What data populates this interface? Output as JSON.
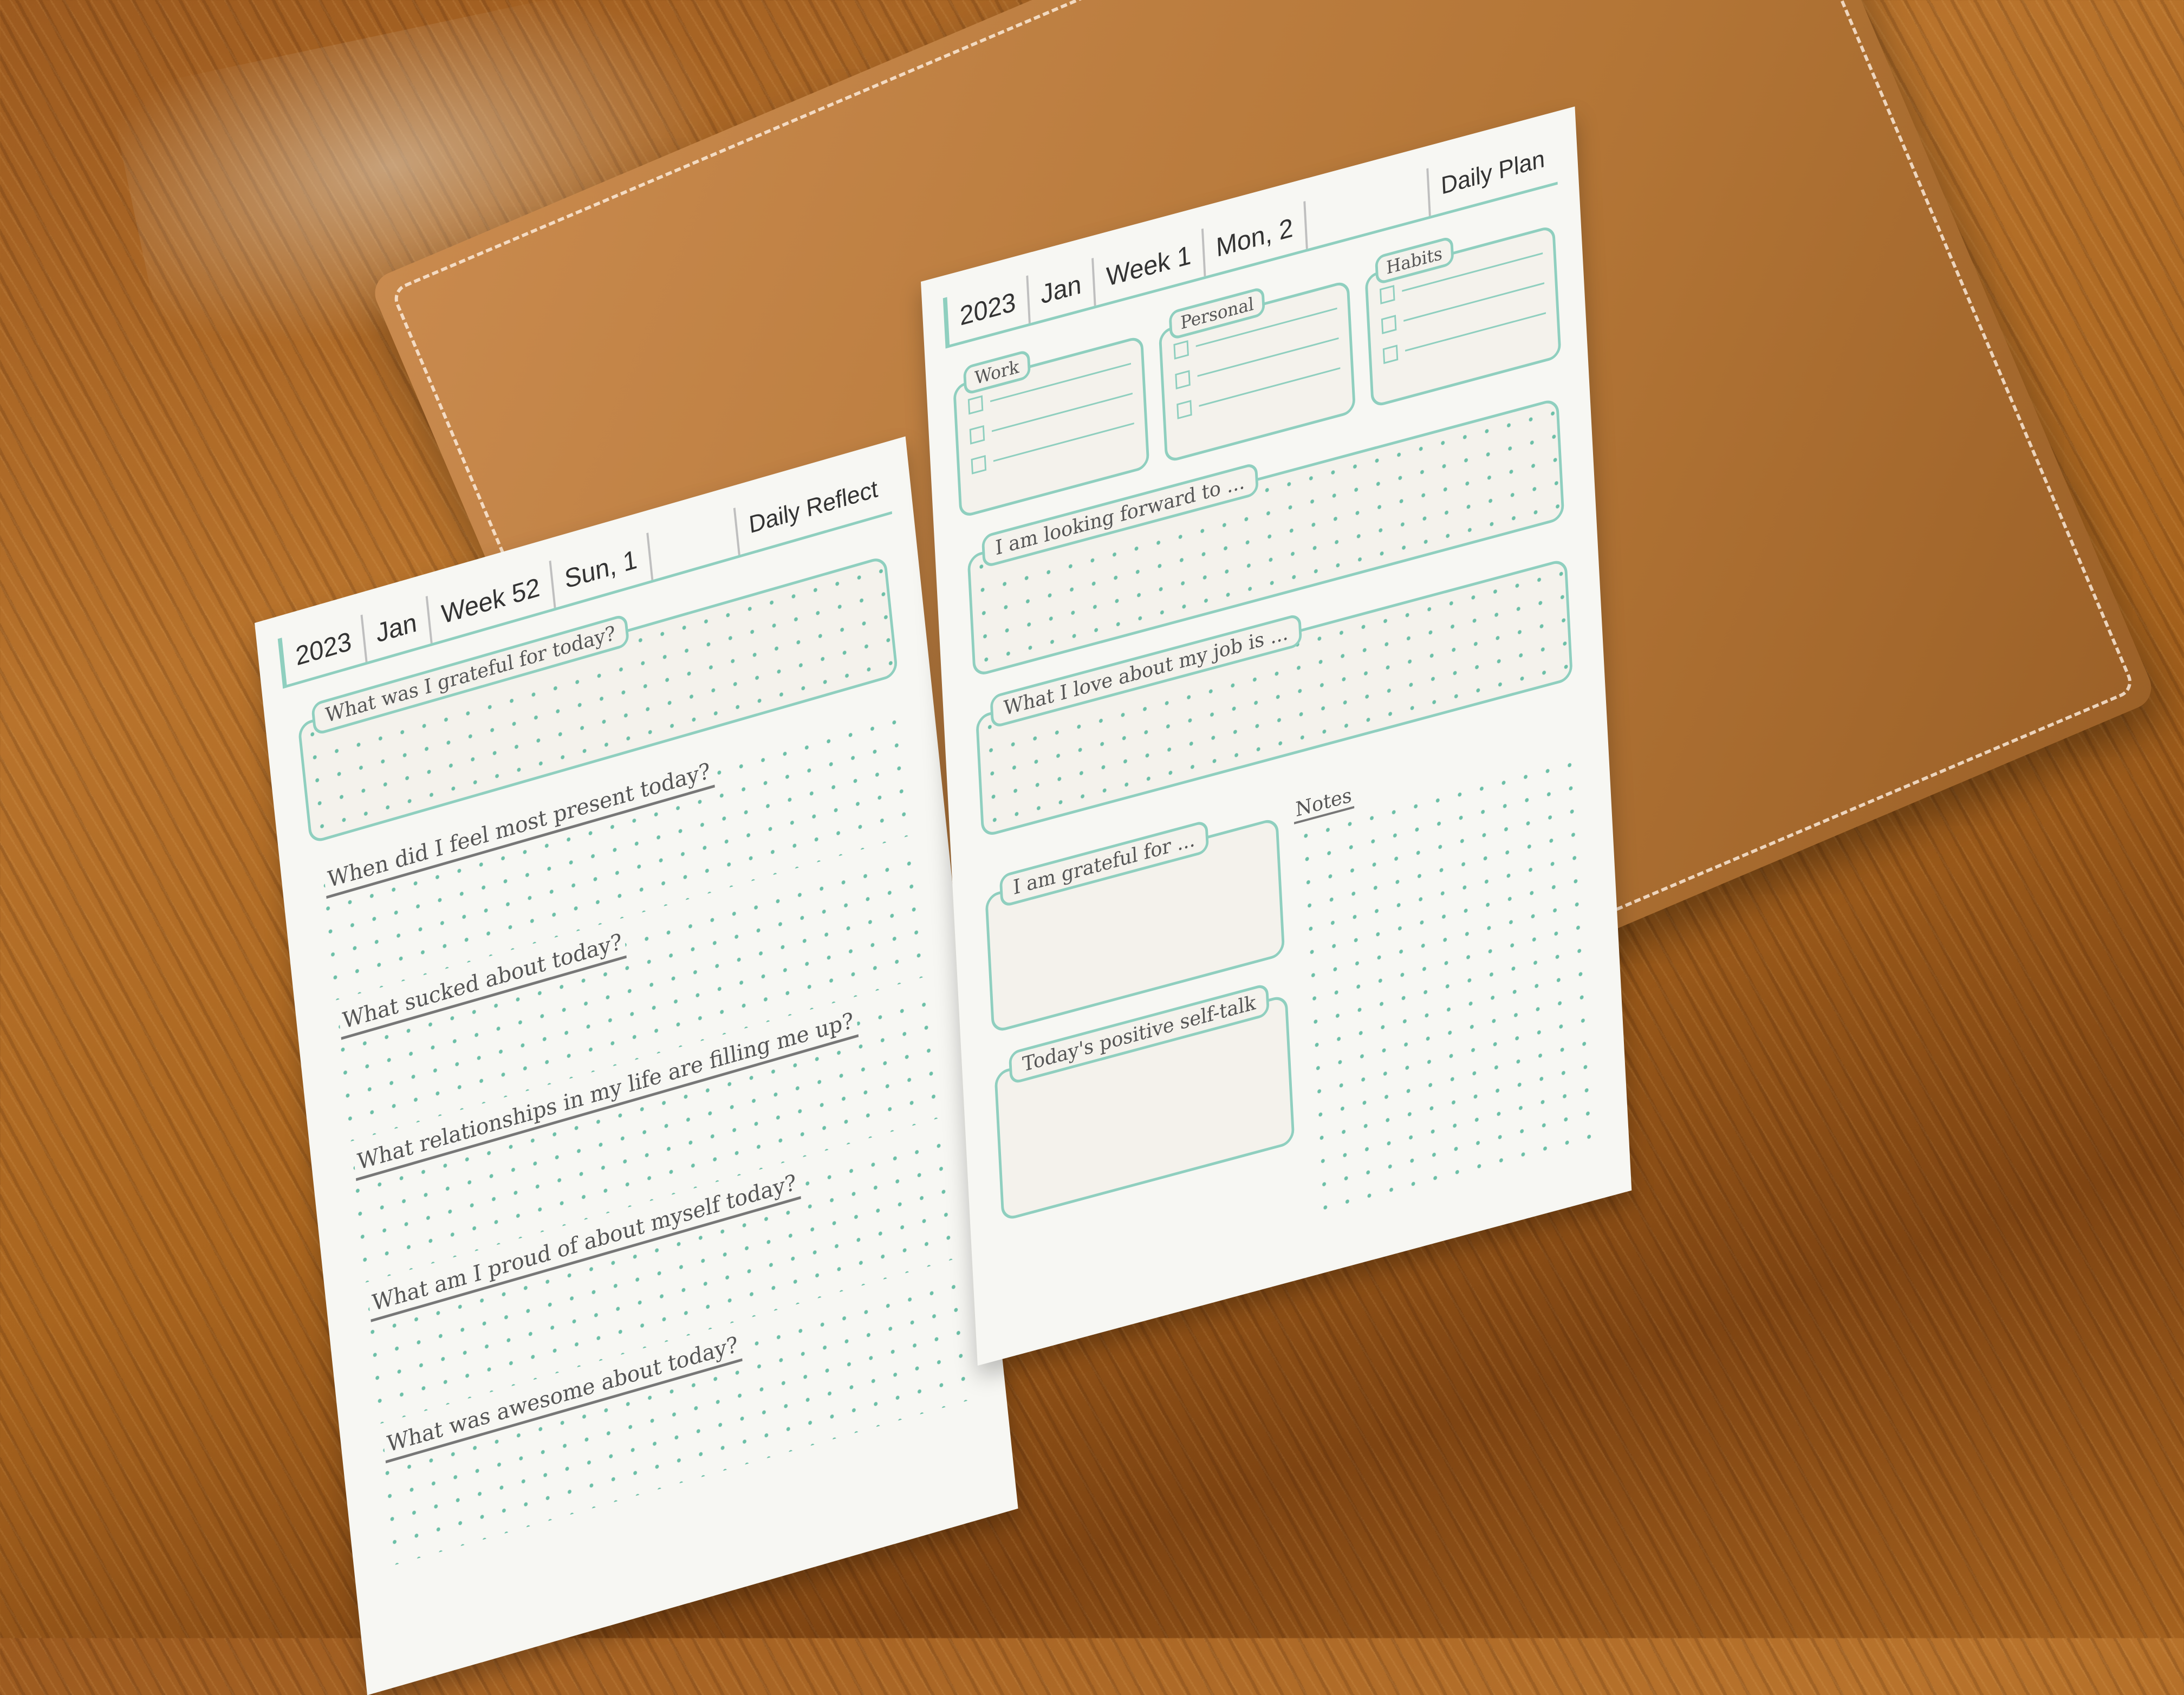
{
  "left_page": {
    "tabs": [
      "2023",
      "Jan",
      "Week 52",
      "Sun, 1"
    ],
    "title": "Daily Reflect",
    "first_prompt": "What was I grateful for today?",
    "prompts": [
      "When did I feel most present today?",
      "What sucked about today?",
      "What relationships in my life are filling me up?",
      "What am I proud of about myself today?",
      "What was awesome about today?"
    ]
  },
  "right_page": {
    "tabs": [
      "2023",
      "Jan",
      "Week 1",
      "Mon, 2"
    ],
    "title": "Daily Plan",
    "lists": [
      "Work",
      "Personal",
      "Habits"
    ],
    "sections": [
      "I am looking forward to ...",
      "What I love about my job is ..."
    ],
    "grateful": "I am grateful for ...",
    "selftalk": "Today's positive self-talk",
    "notes": "Notes"
  }
}
